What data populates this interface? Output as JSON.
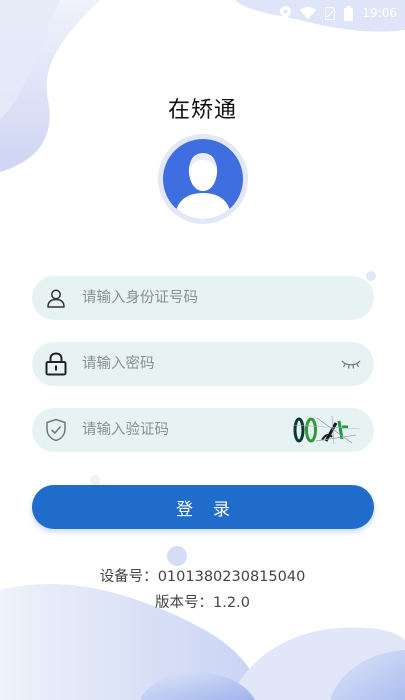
{
  "status_bar": {
    "time": "19:06"
  },
  "app": {
    "title": "在矫通"
  },
  "form": {
    "id_placeholder": "请输入身份证号码",
    "password_placeholder": "请输入密码",
    "captcha_placeholder": "请输入验证码",
    "captcha_text": "0014"
  },
  "login": {
    "label": "登录"
  },
  "device": {
    "label": "设备号：",
    "value": "0101380230815040"
  },
  "version": {
    "label": "版本号：",
    "value": "1.2.0"
  },
  "colors": {
    "accent": "#1f6cca",
    "field_bg": "#e7f3f2",
    "blob": "#dde3f7"
  },
  "icons": [
    "location-icon",
    "wifi-icon",
    "sim-icon",
    "battery-icon",
    "user-icon",
    "lock-icon",
    "eye-closed-icon",
    "shield-icon"
  ]
}
